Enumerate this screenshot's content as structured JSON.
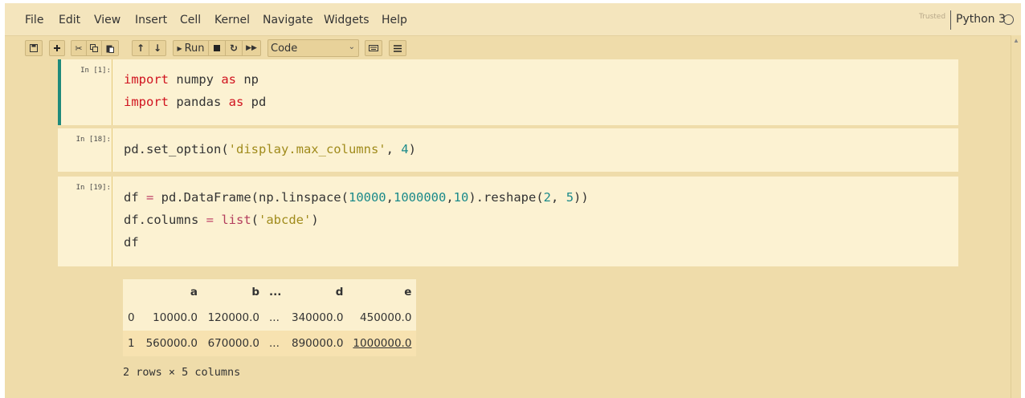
{
  "menu": {
    "items": [
      "File",
      "Edit",
      "View",
      "Insert",
      "Cell",
      "Kernel",
      "Navigate",
      "Widgets",
      "Help"
    ],
    "trusted_label": "Trusted",
    "kernel_name": "Python 3"
  },
  "toolbar": {
    "run_label": "Run",
    "cell_type": "Code",
    "icons": [
      "save-icon",
      "plus-icon",
      "cut-icon",
      "copy-icon",
      "paste-icon",
      "arrow-up-icon",
      "arrow-down-icon",
      "run-icon",
      "stop-icon",
      "restart-icon",
      "fast-forward-icon",
      "keyboard-icon",
      "list-icon"
    ]
  },
  "cells": [
    {
      "prompt": "In [1]:",
      "lines": [
        [
          {
            "t": "import",
            "c": "kw"
          },
          {
            "t": " numpy "
          },
          {
            "t": "as",
            "c": "kw"
          },
          {
            "t": " np"
          }
        ],
        [
          {
            "t": "import",
            "c": "kw"
          },
          {
            "t": " pandas "
          },
          {
            "t": "as",
            "c": "kw"
          },
          {
            "t": " pd"
          }
        ]
      ]
    },
    {
      "prompt": "In [18]:",
      "lines": [
        [
          {
            "t": "pd.set_option("
          },
          {
            "t": "'display.max_columns'",
            "c": "str"
          },
          {
            "t": ", "
          },
          {
            "t": "4",
            "c": "num"
          },
          {
            "t": ")"
          }
        ]
      ]
    },
    {
      "prompt": "In [19]:",
      "lines": [
        [
          {
            "t": "df "
          },
          {
            "t": "=",
            "c": "op"
          },
          {
            "t": " pd.DataFrame(np.linspace("
          },
          {
            "t": "10000",
            "c": "num"
          },
          {
            "t": ","
          },
          {
            "t": "1000000",
            "c": "num"
          },
          {
            "t": ","
          },
          {
            "t": "10",
            "c": "num"
          },
          {
            "t": ").reshape("
          },
          {
            "t": "2",
            "c": "num"
          },
          {
            "t": ", "
          },
          {
            "t": "5",
            "c": "num"
          },
          {
            "t": "))"
          }
        ],
        [
          {
            "t": "df.columns "
          },
          {
            "t": "=",
            "c": "op"
          },
          {
            "t": " "
          },
          {
            "t": "list",
            "c": "bi"
          },
          {
            "t": "("
          },
          {
            "t": "'abcde'",
            "c": "str"
          },
          {
            "t": ")"
          }
        ],
        [
          {
            "t": "df"
          }
        ]
      ]
    }
  ],
  "output": {
    "columns": [
      "",
      "a",
      "b",
      "...",
      "d",
      "e"
    ],
    "rows": [
      [
        "0",
        "10000.0",
        "120000.0",
        "...",
        "340000.0",
        "450000.0"
      ],
      [
        "1",
        "560000.0",
        "670000.0",
        "...",
        "890000.0",
        "1000000.0"
      ]
    ],
    "shape_note": "2 rows × 5 columns"
  },
  "colors": {
    "accent_bar": "#1f8a7b",
    "background": "#efdcaa",
    "cell_bg": "#fcf2d2"
  }
}
